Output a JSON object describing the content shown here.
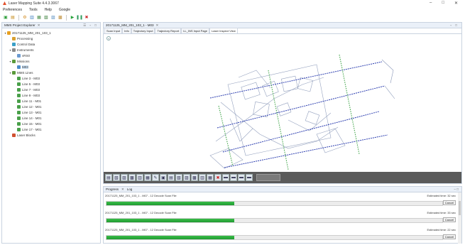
{
  "window": {
    "title": "Laser Mapping Suite 4.4.3.3067",
    "ctrl_min": "–",
    "ctrl_max": "□",
    "ctrl_close": "✕"
  },
  "menu": [
    "Preferences",
    "Tools",
    "Help",
    "Google"
  ],
  "toolbar_icons": [
    {
      "name": "new-icon",
      "glyph": "▣",
      "color": "#2e9e3a"
    },
    {
      "name": "open-icon",
      "glyph": "▤",
      "color": "#c48a1a"
    },
    {
      "name": "settings-icon",
      "glyph": "⚙",
      "color": "#d28a1f"
    },
    {
      "name": "import-icon",
      "glyph": "▥",
      "color": "#3f7fbf"
    },
    {
      "name": "export-icon",
      "glyph": "▦",
      "color": "#4a8f4a"
    },
    {
      "name": "tool-a-icon",
      "glyph": "▧",
      "color": "#3a7f3a"
    },
    {
      "name": "tool-b-icon",
      "glyph": "▨",
      "color": "#5a8fbf"
    },
    {
      "name": "tool-c-icon",
      "glyph": "▩",
      "color": "#bf8f3a"
    },
    {
      "name": "play-icon",
      "glyph": "▶",
      "color": "#27a33b"
    },
    {
      "name": "pause-icon",
      "glyph": "❚❚",
      "color": "#2a9a5a"
    },
    {
      "name": "stop-icon",
      "glyph": "✖",
      "color": "#cc2b2b"
    }
  ],
  "project_panel": {
    "tab_label": "MMS Project Explorer",
    "tab_close": "✕",
    "controls": "☰ ▫ □",
    "tree": [
      {
        "label": "20171125_MM_201_103_1",
        "level": 0,
        "expander": "▾",
        "icon": "#e8a020"
      },
      {
        "label": "Processing",
        "level": 1,
        "expander": "",
        "icon": "#d9a030"
      },
      {
        "label": "Control Data",
        "level": 1,
        "expander": "",
        "icon": "#3aa0c8"
      },
      {
        "label": "Instruments",
        "level": 1,
        "expander": "▾",
        "icon": "#8a8a8a"
      },
      {
        "label": "vRS0",
        "level": 2,
        "expander": "",
        "icon": "#6a9ad0"
      },
      {
        "label": "Missions",
        "level": 1,
        "expander": "▾",
        "icon": "#5a9a3a"
      },
      {
        "label": "M03",
        "level": 2,
        "expander": "",
        "icon": "#4a8ac8",
        "selected": true
      },
      {
        "label": "MMS Lines",
        "level": 1,
        "expander": "▾",
        "icon": "#5a9a3a"
      },
      {
        "label": "Line 3 - M03",
        "level": 2,
        "expander": "",
        "icon": "#4aa04a"
      },
      {
        "label": "Line 5 - M03",
        "level": 2,
        "expander": "",
        "icon": "#4aa04a"
      },
      {
        "label": "Line 7 - M03",
        "level": 2,
        "expander": "",
        "icon": "#4aa04a"
      },
      {
        "label": "Line 9 - M03",
        "level": 2,
        "expander": "",
        "icon": "#4aa04a"
      },
      {
        "label": "Line 11 - M01",
        "level": 2,
        "expander": "",
        "icon": "#4aa04a"
      },
      {
        "label": "Line 12 - M01",
        "level": 2,
        "expander": "",
        "icon": "#4aa04a"
      },
      {
        "label": "Line 13 - M01",
        "level": 2,
        "expander": "",
        "icon": "#4aa04a"
      },
      {
        "label": "Line 14 - M01",
        "level": 2,
        "expander": "",
        "icon": "#4aa04a"
      },
      {
        "label": "Line 15 - M01",
        "level": 2,
        "expander": "",
        "icon": "#4aa04a"
      },
      {
        "label": "Line 17 - M01",
        "level": 2,
        "expander": "",
        "icon": "#4aa04a"
      },
      {
        "label": "Laser Blocks",
        "level": 1,
        "expander": "",
        "icon": "#d05030"
      }
    ]
  },
  "editor": {
    "tab_label": "20171125_MM_201_103_1 - M03",
    "tab_close": "✕",
    "controls": "▫ □",
    "subtabs": [
      "Scan Input",
      "Info",
      "Trajectory Input",
      "Trajectory Report",
      "LL_INS Input Page",
      "Laser Inspect View"
    ],
    "active_subtab": 5,
    "zoom_glyph": "+"
  },
  "view_tools": [
    "▤",
    "▧",
    "▨",
    "▩",
    "▥",
    "▦",
    "✎",
    "▣",
    "▤",
    "▧",
    "▨",
    "▩",
    "▥",
    "▦",
    "✖",
    "▬",
    "▬",
    "▬",
    "▬"
  ],
  "progress_panel": {
    "tab_progress": "Progress",
    "tab_log": "Log",
    "tab_close": "✕",
    "controls": "– □",
    "jobs": [
      {
        "name": "20171125_MM_201_103_1 - M07 - 12 Decode Scan File",
        "remaining": "Estimated time: 32 sec",
        "progress": 0.38,
        "cancel": "Cancel"
      },
      {
        "name": "20171125_MM_201_103_1 - M07 - 12 Decode Scan File",
        "remaining": "Estimated time: 33 sec",
        "progress": 0.38,
        "cancel": "Cancel"
      },
      {
        "name": "20171125_MM_201_103_1 - M07 - 12 Decode Scan File",
        "remaining": "Estimated time: 22 sec",
        "progress": 0.38,
        "cancel": "Cancel"
      }
    ]
  }
}
